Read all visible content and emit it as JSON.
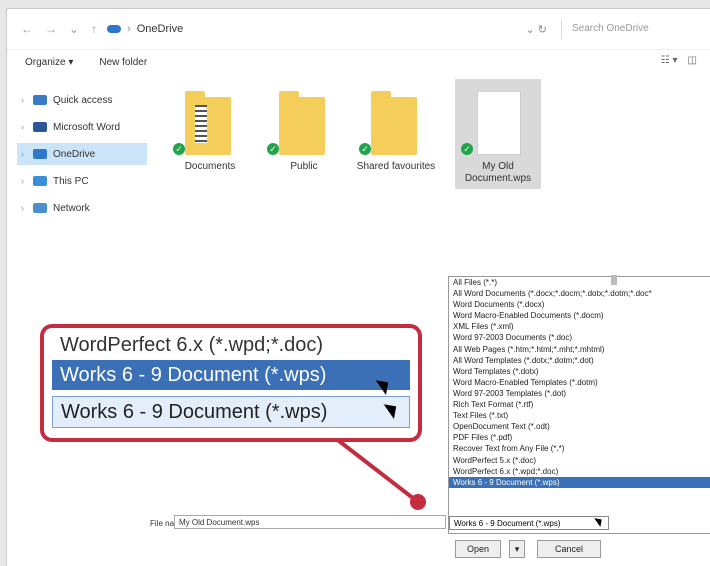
{
  "address": {
    "breadcrumb_sep": "›",
    "location": "OneDrive",
    "refresh_glyph": "⌄ ↻",
    "search_placeholder": "Search OneDrive"
  },
  "toolbar": {
    "organize_label": "Organize ▾",
    "new_folder_label": "New folder",
    "view_glyph": "☷ ▾",
    "pane_glyph": "◫"
  },
  "sidebar": {
    "items": [
      {
        "label": "Quick access",
        "color": "#3b78c8",
        "chev": "›",
        "selected": false
      },
      {
        "label": "Microsoft Word",
        "color": "#2b579a",
        "chev": "›",
        "selected": false
      },
      {
        "label": "OneDrive",
        "color": "#2e77c9",
        "chev": "›",
        "selected": true
      },
      {
        "label": "This PC",
        "color": "#3a8fd6",
        "chev": "›",
        "selected": false
      },
      {
        "label": "Network",
        "color": "#4a90d0",
        "chev": "›",
        "selected": false
      }
    ]
  },
  "files": [
    {
      "label": "Documents",
      "kind": "folder-docs"
    },
    {
      "label": "Public",
      "kind": "folder"
    },
    {
      "label": "Shared favourites",
      "kind": "folder"
    },
    {
      "label": "My Old Document.wps",
      "kind": "doc",
      "selected": true
    }
  ],
  "dropdown": {
    "options": [
      "All Files (*.*)",
      "All Word Documents (*.docx;*.docm;*.dotx;*.dotm;*.doc*",
      "Word Documents (*.docx)",
      "Word Macro-Enabled Documents (*.docm)",
      "XML Files (*.xml)",
      "Word 97-2003 Documents (*.doc)",
      "All Web Pages (*.htm;*.html;*.mht;*.mhtml)",
      "All Word Templates (*.dotx;*.dotm;*.dot)",
      "Word Templates (*.dotx)",
      "Word Macro-Enabled Templates (*.dotm)",
      "Word 97-2003 Templates (*.dot)",
      "Rich Text Format (*.rtf)",
      "Text Files (*.txt)",
      "OpenDocument Text (*.odt)",
      "PDF Files (*.pdf)",
      "Recover Text from Any File (*.*)",
      "WordPerfect 5.x (*.doc)",
      "WordPerfect 6.x (*.wpd;*.doc)",
      "Works 6 - 9 Document (*.wps)"
    ],
    "highlighted_index": 18,
    "selected_value": "Works 6 - 9 Document (*.wps)"
  },
  "filename": {
    "label": "File name:",
    "value": "My Old Document.wps"
  },
  "buttons": {
    "open": "Open",
    "open_split": "▾",
    "cancel": "Cancel"
  },
  "callout": {
    "row1": "WordPerfect 6.x (*.wpd;*.doc)",
    "row2": "Works 6 - 9 Document (*.wps)",
    "row3": "Works 6 - 9 Document (*.wps)",
    "border_color": "#c42c3f",
    "highlight_color": "#3b6fb6"
  },
  "icons": {
    "back": "back-arrow-icon",
    "forward": "forward-arrow-icon",
    "recent": "recent-chevron-icon",
    "up": "up-arrow-icon",
    "check_glyph": "✓"
  }
}
